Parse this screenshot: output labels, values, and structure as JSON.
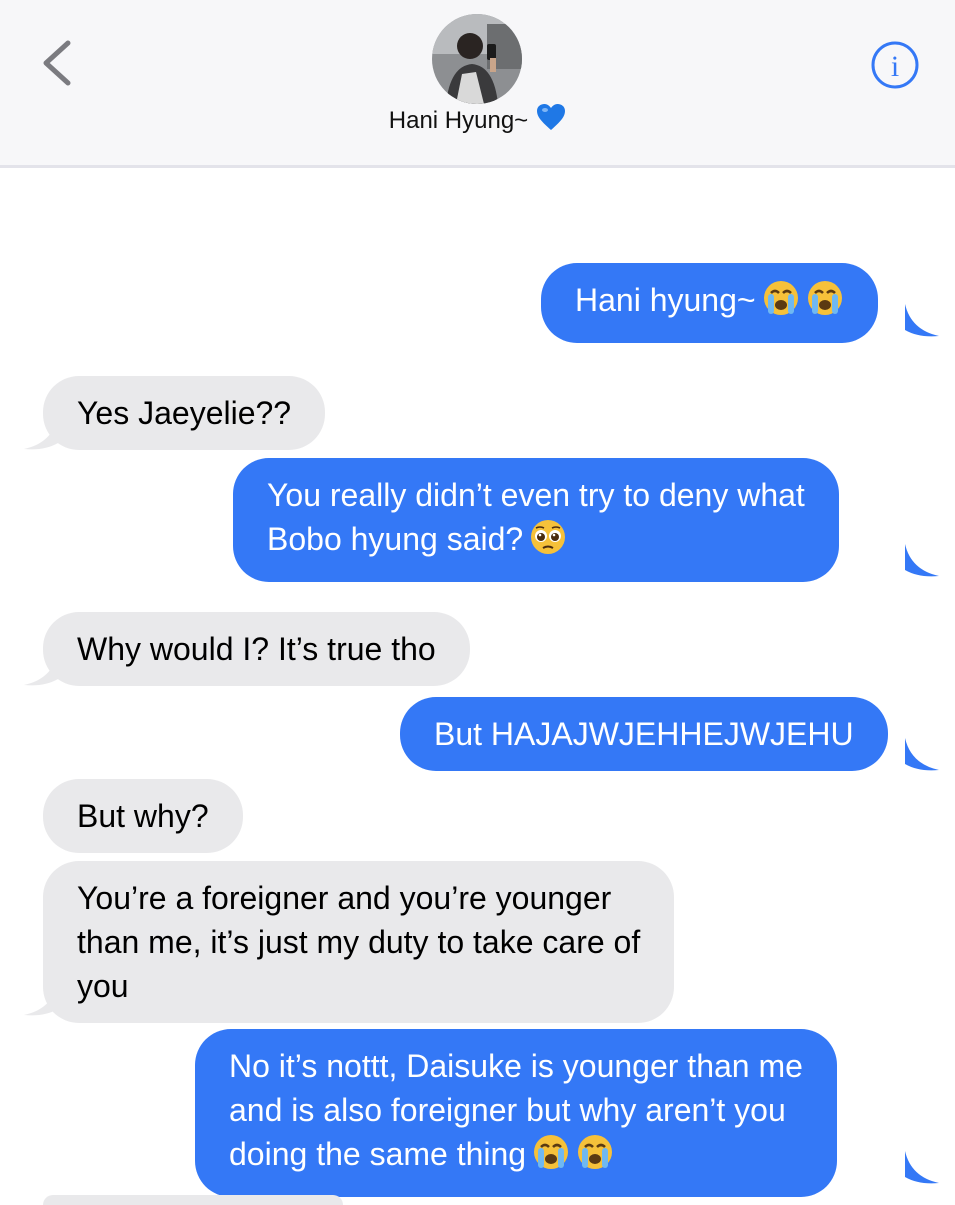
{
  "header": {
    "contact_name": "Hani Hyung~",
    "heart_icon": "blue-heart-icon",
    "back_icon": "chevron-left-icon",
    "info_icon": "info-circle-icon",
    "accent_color": "#3478f6"
  },
  "messages": [
    {
      "direction": "outgoing",
      "lines": [
        "Hani hyung~"
      ],
      "emoji": [
        "loudly-crying-face",
        "loudly-crying-face"
      ]
    },
    {
      "direction": "incoming",
      "lines": [
        "Yes Jaeyelie??"
      ]
    },
    {
      "direction": "outgoing",
      "lines": [
        "You really didn’t even try to deny what",
        "Bobo hyung said?"
      ],
      "emoji": [
        "pleading-face"
      ]
    },
    {
      "direction": "incoming",
      "lines": [
        "Why would I? It’s true tho"
      ]
    },
    {
      "direction": "outgoing",
      "lines": [
        "But HAJAJWJEHHEJWJEHU"
      ]
    },
    {
      "direction": "incoming",
      "lines": [
        "But why?"
      ]
    },
    {
      "direction": "incoming",
      "lines": [
        "You’re a foreigner and you’re younger",
        "than me, it’s just my duty to take care of",
        "you"
      ]
    },
    {
      "direction": "outgoing",
      "lines": [
        "No it’s nottt, Daisuke is younger than me",
        "and is also foreigner but why aren’t you",
        "doing the same thing"
      ],
      "emoji": [
        "loudly-crying-face",
        "loudly-crying-face"
      ]
    }
  ],
  "colors": {
    "outgoing_bubble": "#3478f6",
    "incoming_bubble": "#e9e9eb",
    "header_bg": "#f7f7f9"
  }
}
